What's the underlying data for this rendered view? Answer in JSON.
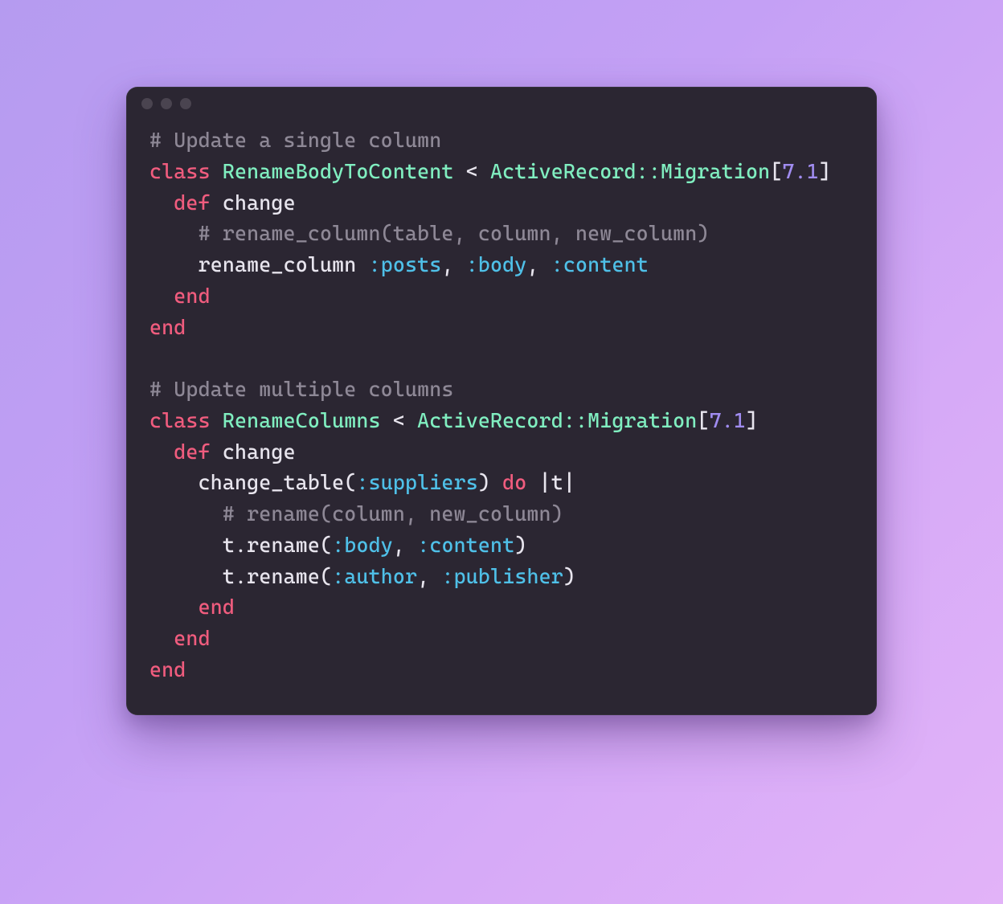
{
  "code": {
    "l1_comment": "# Update a single column",
    "l2_class": "class ",
    "l2_name": "RenameBodyToContent",
    "l2_lt": " < ",
    "l2_base": "ActiveRecord::Migration",
    "l2_open": "[",
    "l2_ver": "7.1",
    "l2_close": "]",
    "l3_def": "  def ",
    "l3_name": "change",
    "l4_comment": "    # rename_column(table, column, new_column)",
    "l5_indent": "    ",
    "l5_call": "rename_column",
    "l5_sp": " ",
    "l5_a": ":posts",
    "l5_c1": ", ",
    "l5_b": ":body",
    "l5_c2": ", ",
    "l5_c": ":content",
    "l6_end": "  end",
    "l7_end": "end",
    "blank": "",
    "l9_comment": "# Update multiple columns",
    "l10_class": "class ",
    "l10_name": "RenameColumns",
    "l10_lt": " < ",
    "l10_base": "ActiveRecord::Migration",
    "l10_open": "[",
    "l10_ver": "7.1",
    "l10_close": "]",
    "l11_def": "  def ",
    "l11_name": "change",
    "l12_indent": "    ",
    "l12_call": "change_table",
    "l12_open": "(",
    "l12_arg": ":suppliers",
    "l12_close": ") ",
    "l12_do": "do",
    "l12_pipe1": " |",
    "l12_t": "t",
    "l12_pipe2": "|",
    "l13_comment": "      # rename(column, new_column)",
    "l14_indent": "      ",
    "l14_recv": "t",
    "l14_dot": ".",
    "l14_meth": "rename",
    "l14_open": "(",
    "l14_a": ":body",
    "l14_c1": ", ",
    "l14_b": ":content",
    "l14_close": ")",
    "l15_indent": "      ",
    "l15_recv": "t",
    "l15_dot": ".",
    "l15_meth": "rename",
    "l15_open": "(",
    "l15_a": ":author",
    "l15_c1": ", ",
    "l15_b": ":publisher",
    "l15_close": ")",
    "l16_end": "    end",
    "l17_end": "  end",
    "l18_end": "end"
  }
}
